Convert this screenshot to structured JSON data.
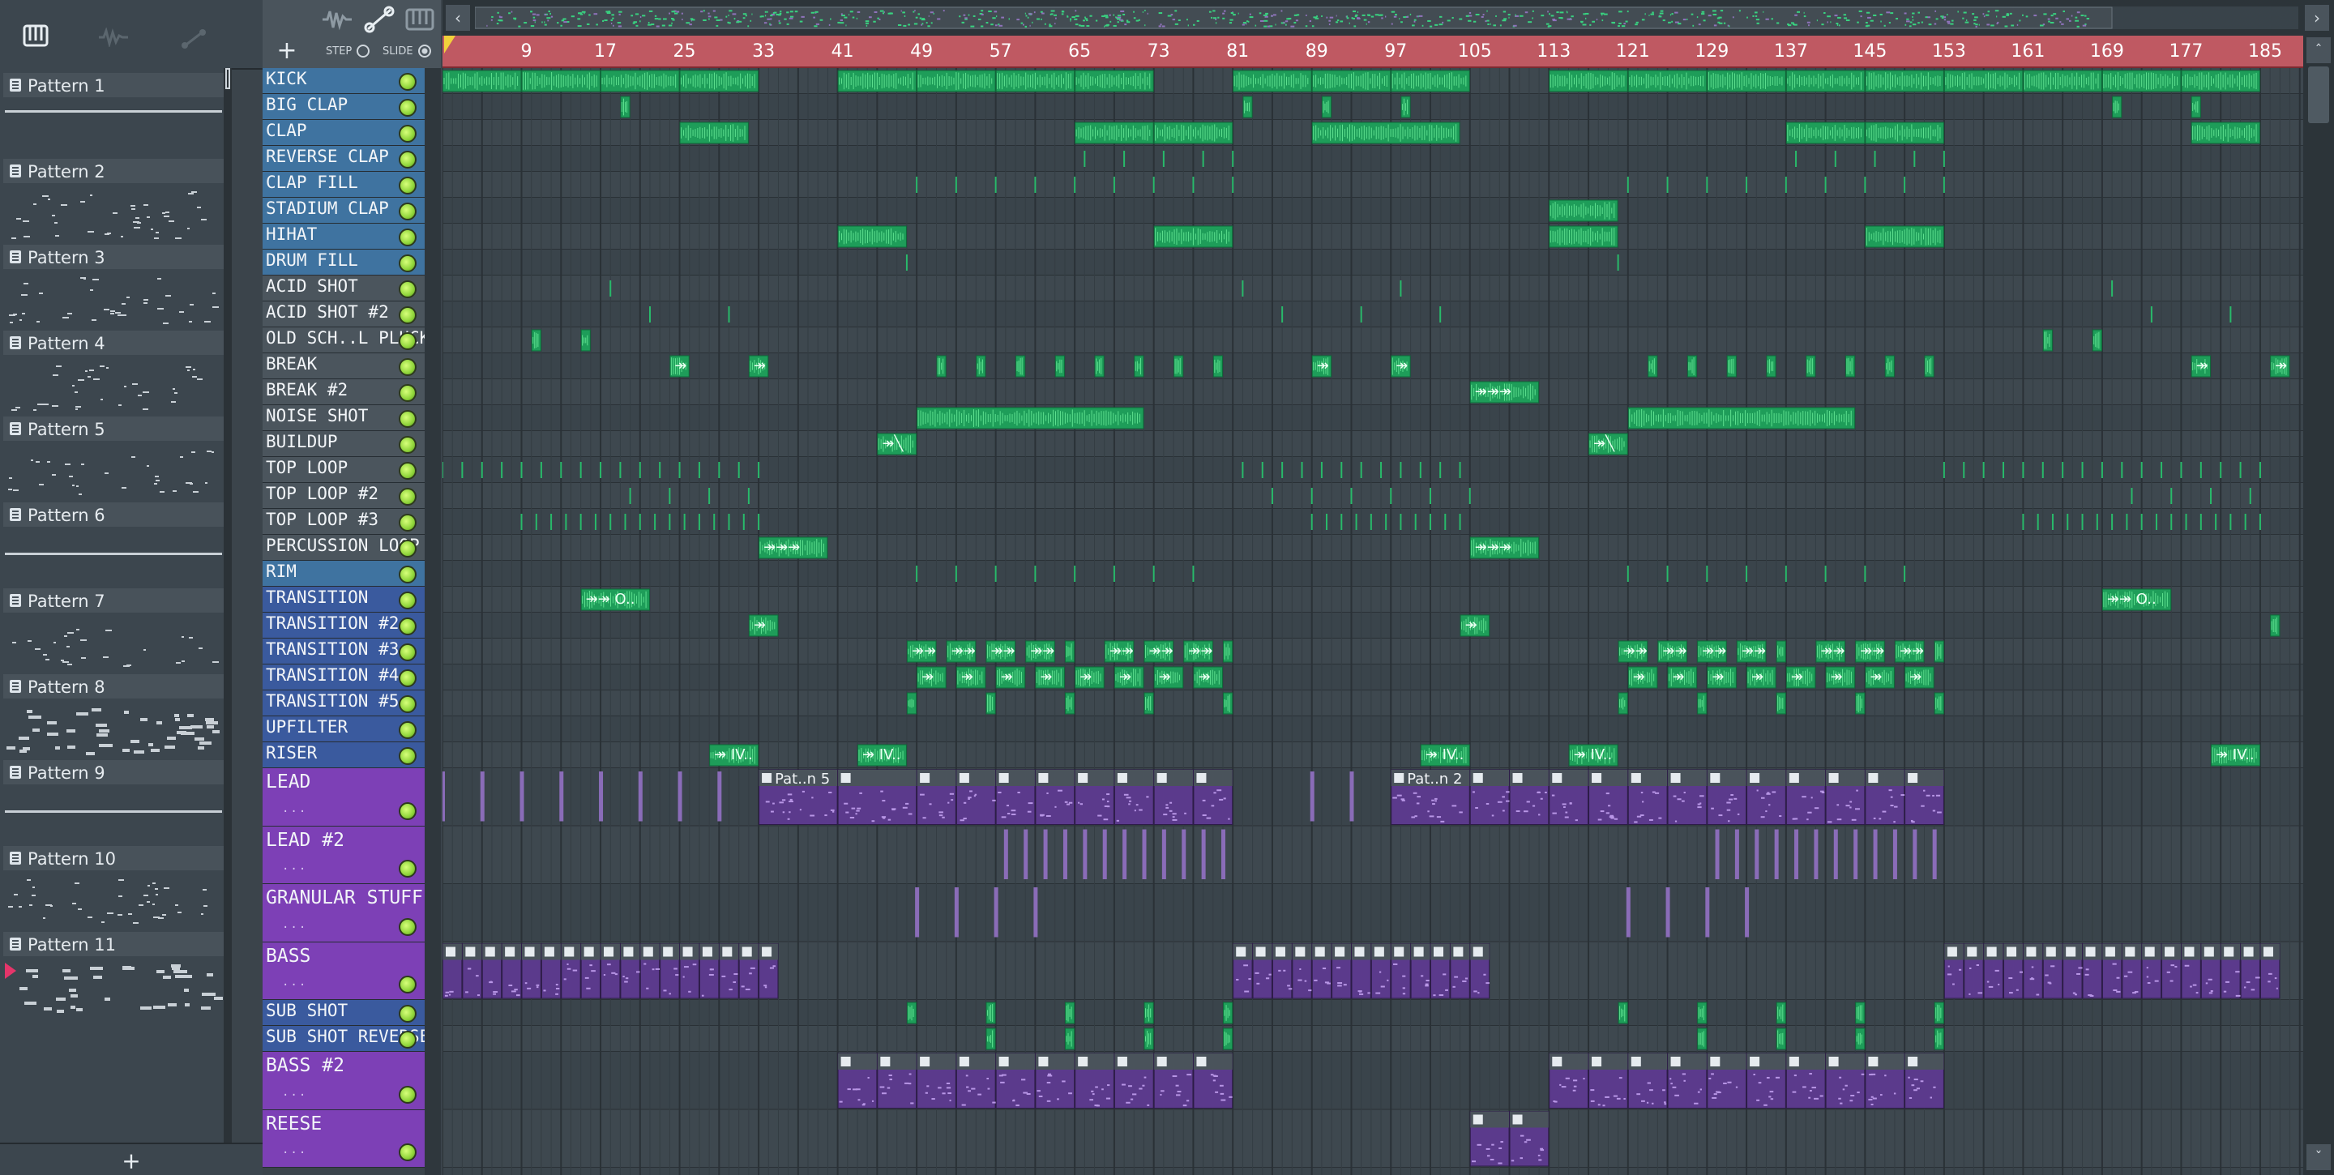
{
  "toolbar": {
    "plus": "+",
    "step_label": "STEP",
    "slide_label": "SLIDE"
  },
  "picker": {
    "add_label": "+",
    "patterns": [
      "Pattern 1",
      "Pattern 2",
      "Pattern 3",
      "Pattern 4",
      "Pattern 5",
      "Pattern 6",
      "Pattern 7",
      "Pattern 8",
      "Pattern 9",
      "Pattern 10",
      "Pattern 11"
    ],
    "selected": "Pattern 11"
  },
  "ruler": {
    "bars": [
      "9",
      "17",
      "25",
      "33",
      "41",
      "49",
      "57",
      "65",
      "73",
      "81",
      "89",
      "97",
      "105",
      "113",
      "121",
      "129",
      "137",
      "145",
      "153",
      "161",
      "169",
      "177",
      "185"
    ]
  },
  "tracks": [
    {
      "name": "KICK",
      "type": "audio"
    },
    {
      "name": "BIG CLAP",
      "type": "audio"
    },
    {
      "name": "CLAP",
      "type": "audio"
    },
    {
      "name": "REVERSE CLAP",
      "type": "audio"
    },
    {
      "name": "CLAP FILL",
      "type": "audio"
    },
    {
      "name": "STADIUM CLAP",
      "type": "audio"
    },
    {
      "name": "HIHAT",
      "type": "audio"
    },
    {
      "name": "DRUM FILL",
      "type": "audio"
    },
    {
      "name": "ACID SHOT",
      "type": "gray"
    },
    {
      "name": "ACID SHOT #2",
      "type": "gray"
    },
    {
      "name": "OLD SCH..L PLUCKS",
      "type": "gray"
    },
    {
      "name": "BREAK",
      "type": "gray"
    },
    {
      "name": "BREAK #2",
      "type": "gray"
    },
    {
      "name": "NOISE SHOT",
      "type": "gray"
    },
    {
      "name": "BUILDUP",
      "type": "gray"
    },
    {
      "name": "TOP LOOP",
      "type": "gray"
    },
    {
      "name": "TOP LOOP #2",
      "type": "gray"
    },
    {
      "name": "TOP LOOP #3",
      "type": "gray"
    },
    {
      "name": "PERCUSSION LOOP",
      "type": "gray"
    },
    {
      "name": "RIM",
      "type": "audio"
    },
    {
      "name": "TRANSITION",
      "type": "fx"
    },
    {
      "name": "TRANSITION #2",
      "type": "fx"
    },
    {
      "name": "TRANSITION #3",
      "type": "fx"
    },
    {
      "name": "TRANSITION #4",
      "type": "fx"
    },
    {
      "name": "TRANSITION #5",
      "type": "fx"
    },
    {
      "name": "UPFILTER",
      "type": "fx"
    },
    {
      "name": "RISER",
      "type": "fx"
    },
    {
      "name": "LEAD",
      "type": "pattern"
    },
    {
      "name": "LEAD #2",
      "type": "pattern"
    },
    {
      "name": "GRANULAR STUFF",
      "type": "pattern"
    },
    {
      "name": "BASS",
      "type": "pattern"
    },
    {
      "name": "SUB SHOT",
      "type": "fx"
    },
    {
      "name": "SUB SHOT REVERSE",
      "type": "fx"
    },
    {
      "name": "BASS #2",
      "type": "pattern"
    },
    {
      "name": "REESE",
      "type": "pattern"
    }
  ],
  "clip_labels": {
    "lead_a": "Pat..n 5",
    "lead_b": "Pat..n 2",
    "transition": "O..",
    "riser": "IV.."
  },
  "colors": {
    "ruler": "#bf5962",
    "audio_track": "#3f73a0",
    "gray_track": "#4b555d",
    "fx_track": "#3a5a9e",
    "pattern_track": "#7d40b6",
    "clip_green": "#1fa85f",
    "clip_purple": "#5b3a8c"
  }
}
